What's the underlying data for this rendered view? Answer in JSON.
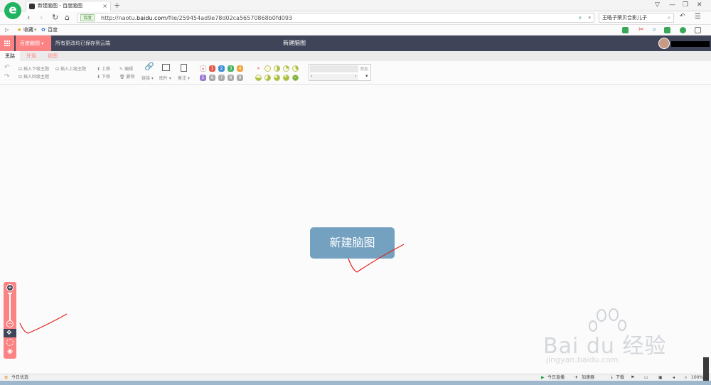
{
  "browser": {
    "tab_title": "新建脑图 - 百度脑图",
    "new_tab": "+",
    "url_badge": "百度",
    "url_prefix": "http://naotu.",
    "url_domain": "baidu.com",
    "url_path": "/file/259454ad9e78d02ca56570868b0fd093",
    "search_text": "王晧子荣贝合影儿子"
  },
  "bookmarks": {
    "favorites_label": "收藏",
    "baidu_label": "百度"
  },
  "app": {
    "brand_label": "百度脑图",
    "save_message": "所有更改均已保存到云端",
    "doc_title": "新建脑图",
    "tabs": [
      "思路",
      "外观",
      "视图"
    ]
  },
  "toolbar": {
    "insert_child": "插入下级主题",
    "insert_parent": "插入上级主题",
    "insert_sibling": "插入同级主题",
    "move_up": "上移",
    "move_down": "下移",
    "edit": "编辑",
    "delete": "删除",
    "link": "链接",
    "image": "图片",
    "note": "备注",
    "priorities": [
      "1",
      "2",
      "3",
      "4",
      "5",
      "6",
      "7",
      "8",
      "9"
    ],
    "add_label": "添加"
  },
  "canvas": {
    "root_node": "新建脑图"
  },
  "watermark": {
    "brand": "Bai du 经验",
    "url": "jingyan.baidu.com"
  },
  "status": {
    "today_pick": "今日优选",
    "live": "今日直播",
    "accelerator": "加速器",
    "download": "下载",
    "zoom": "100%"
  },
  "colors": {
    "accent": "#fc8383",
    "header_bg": "#404458",
    "root_node_bg": "#73a1bf",
    "annotation_red": "#e32222"
  }
}
